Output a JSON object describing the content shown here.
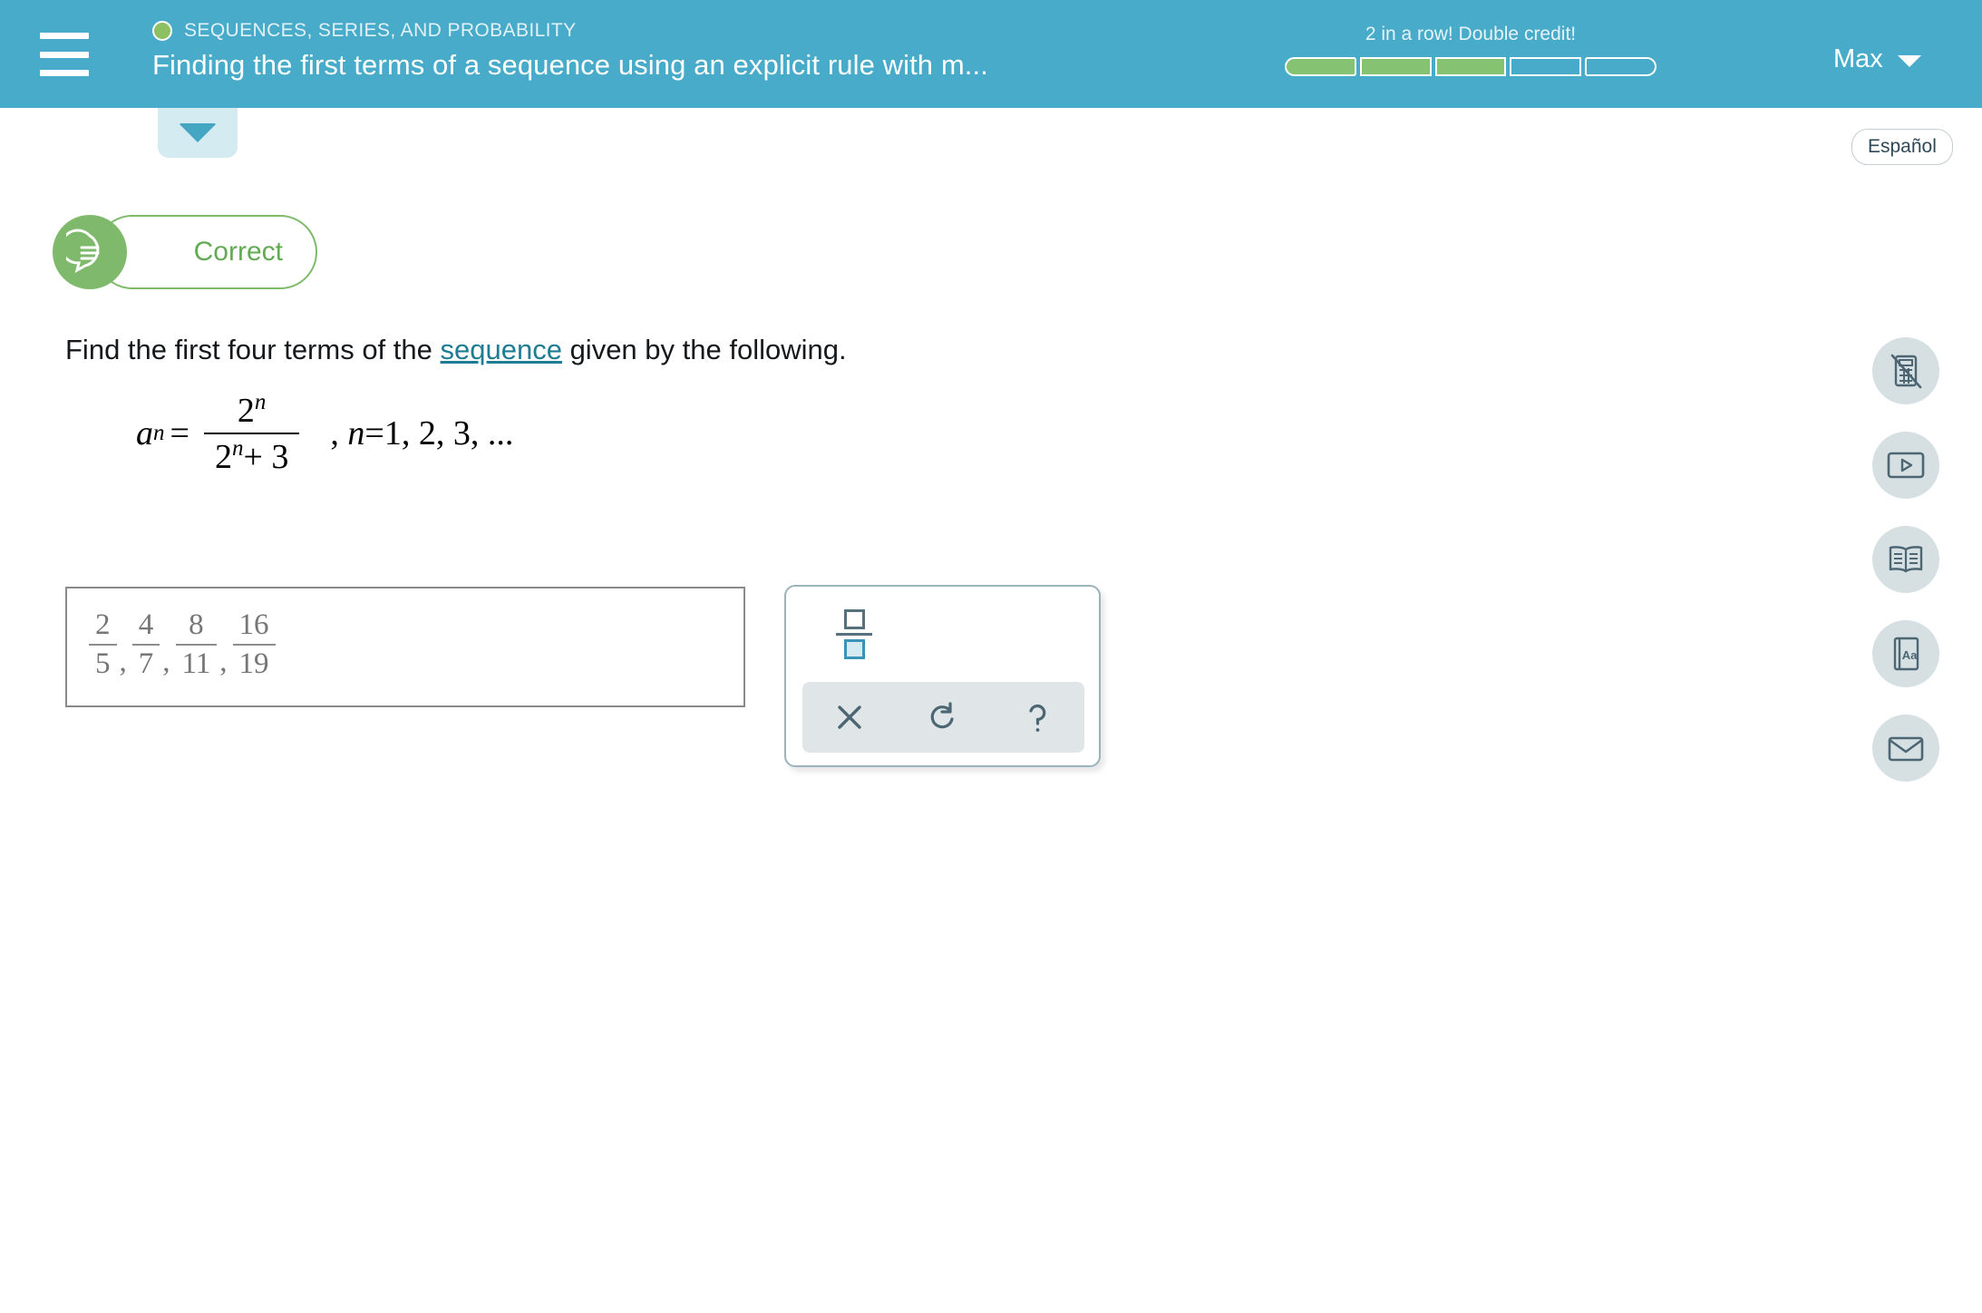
{
  "header": {
    "menu_icon": "hamburger-menu-icon",
    "objective_icon": "progress-ring-icon",
    "objective": "SEQUENCES, SERIES, AND PROBABILITY",
    "assignment_title": "Finding the first terms of a sequence using an explicit rule with m...",
    "streak_text": "2 in a row! Double credit!",
    "progress": {
      "total_segments": 5,
      "filled_segments": 3
    },
    "user_name": "Max",
    "caret_icon": "chevron-down-icon",
    "accent_color": "#47abc9",
    "progress_fill_color": "#85c272"
  },
  "pull_tab": {
    "icon": "triangle-down-icon"
  },
  "language_button": {
    "label": "Español"
  },
  "feedback": {
    "status": "Correct",
    "icon": "speech-bubble-icon",
    "color": "#7fba6c"
  },
  "question": {
    "prefix": "Find the first four terms of the ",
    "link": "sequence",
    "suffix": " given by the following.",
    "link_color": "#1f7c93"
  },
  "formula": {
    "lhs_var": "a",
    "lhs_sub": "n",
    "equals": "=",
    "numerator_base": "2",
    "numerator_exp": "n",
    "denominator_base": "2",
    "denominator_exp": "n",
    "denominator_rest": "+ 3",
    "domain_prefix": ",",
    "domain_var": "n",
    "domain_equals": "=",
    "domain_values": "1, 2, 3, ..."
  },
  "answer": {
    "terms": [
      {
        "num": "2",
        "den": "5"
      },
      {
        "num": "4",
        "den": "7"
      },
      {
        "num": "8",
        "den": "11"
      },
      {
        "num": "16",
        "den": "19"
      }
    ],
    "separator": ",",
    "text_color": "#767676"
  },
  "math_palette": {
    "fraction_tool": "fraction-template-icon",
    "actions": [
      {
        "name": "clear-button",
        "icon": "x-icon"
      },
      {
        "name": "undo-button",
        "icon": "undo-arrow-icon"
      },
      {
        "name": "help-button",
        "icon": "question-mark-icon"
      }
    ]
  },
  "tool_rail": [
    {
      "name": "calculator-disabled-icon",
      "label": "calculator-off"
    },
    {
      "name": "video-play-icon",
      "label": "video"
    },
    {
      "name": "open-book-icon",
      "label": "reference"
    },
    {
      "name": "dictionary-icon",
      "label": "glossary"
    },
    {
      "name": "envelope-icon",
      "label": "message"
    }
  ]
}
